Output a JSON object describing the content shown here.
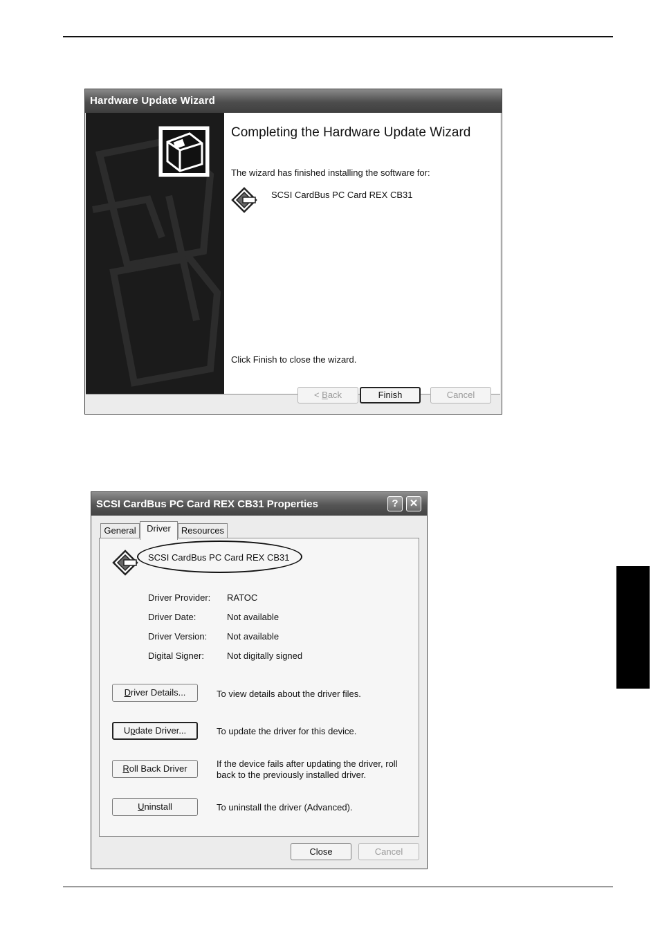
{
  "wizard": {
    "title": "Hardware Update Wizard",
    "heading": "Completing the Hardware Update Wizard",
    "finished_text": "The wizard has finished installing the software for:",
    "device_name": "SCSI CardBus PC Card REX CB31",
    "close_text": "Click Finish to close the wizard.",
    "buttons": {
      "back_prefix": "< ",
      "back_mnemonic": "B",
      "back_rest": "ack",
      "finish": "Finish",
      "cancel": "Cancel"
    }
  },
  "properties": {
    "title": "SCSI CardBus PC Card REX CB31 Properties",
    "help_glyph": "?",
    "close_glyph": "✕",
    "tabs": [
      "General",
      "Driver",
      "Resources"
    ],
    "active_tab": "Driver",
    "device_name": "SCSI CardBus PC Card REX CB31",
    "info": [
      {
        "label": "Driver Provider:",
        "value": "RATOC"
      },
      {
        "label": "Driver Date:",
        "value": "Not available"
      },
      {
        "label": "Driver Version:",
        "value": "Not available"
      },
      {
        "label": "Digital Signer:",
        "value": "Not digitally signed"
      }
    ],
    "actions": [
      {
        "mnemonic": "D",
        "rest": "river Details...",
        "pre": "",
        "description": "To view details about the driver files."
      },
      {
        "pre": "U",
        "mnemonic": "p",
        "rest": "date Driver...",
        "description": "To update the driver for this device."
      },
      {
        "pre": "",
        "mnemonic": "R",
        "rest": "oll Back Driver",
        "description": "If the device fails after updating the driver, roll back to the previously installed driver."
      },
      {
        "pre": "",
        "mnemonic": "U",
        "rest": "ninstall",
        "description": "To uninstall the driver (Advanced)."
      }
    ],
    "buttons": {
      "close": "Close",
      "cancel": "Cancel"
    }
  },
  "icons": [
    "hardware-wizard-icon",
    "device-icon",
    "help-icon",
    "close-icon"
  ]
}
